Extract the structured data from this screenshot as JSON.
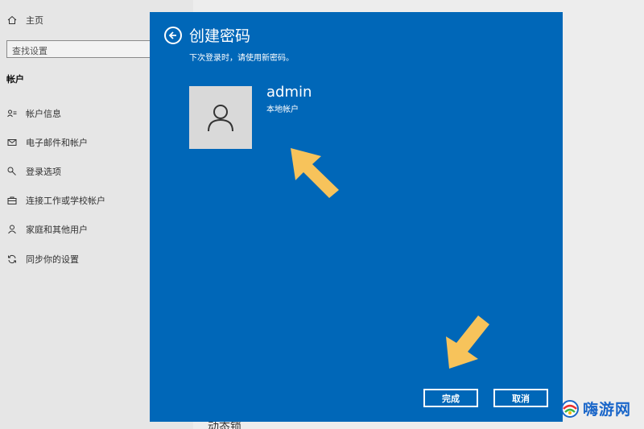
{
  "sidebar": {
    "home_label": "主页",
    "search_placeholder": "查找设置",
    "section_title": "帐户",
    "items": [
      {
        "label": "帐户信息",
        "icon": "account-info-icon"
      },
      {
        "label": "电子邮件和帐户",
        "icon": "mail-icon"
      },
      {
        "label": "登录选项",
        "icon": "key-icon"
      },
      {
        "label": "连接工作或学校帐户",
        "icon": "briefcase-icon"
      },
      {
        "label": "家庭和其他用户",
        "icon": "person-icon"
      },
      {
        "label": "同步你的设置",
        "icon": "sync-icon"
      }
    ]
  },
  "background": {
    "bottom_peek": "动态锁"
  },
  "dialog": {
    "title": "创建密码",
    "subtitle": "下次登录时，请使用新密码。",
    "user_name": "admin",
    "user_type": "本地帐户",
    "done_label": "完成",
    "cancel_label": "取消",
    "accent_color": "#0067b8"
  },
  "watermark": {
    "text": "嗨游网"
  }
}
